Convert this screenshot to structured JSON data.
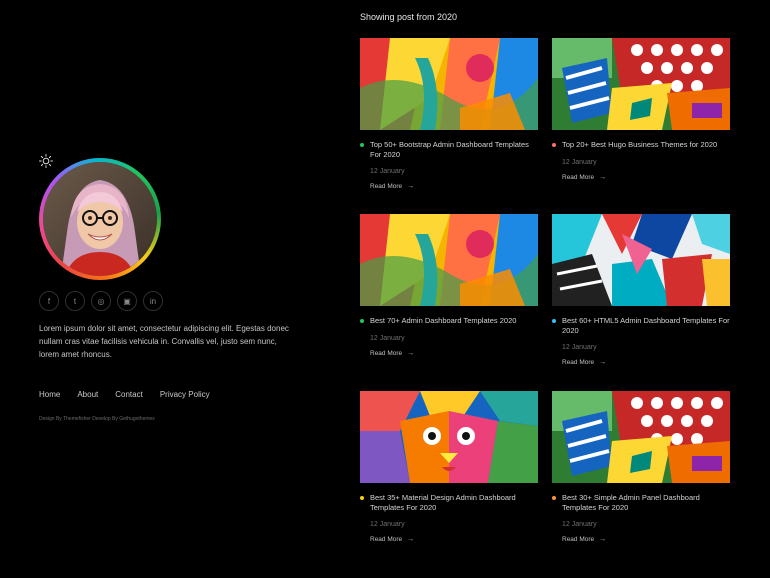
{
  "profile": {
    "theme_icon": "sun-icon",
    "avatar_icon": "avatar-photo",
    "bio": "Lorem ipsum dolor sit amet, consectetur adipiscing elit. Egestas donec nullam cras vitae facilisis vehicula in. Convallis vel, justo sem nunc, lorem amet rhoncus."
  },
  "social": [
    {
      "name": "facebook",
      "label": "f"
    },
    {
      "name": "twitter",
      "label": "t"
    },
    {
      "name": "instagram",
      "label": "◎"
    },
    {
      "name": "github",
      "label": "▣"
    },
    {
      "name": "linkedin",
      "label": "in"
    }
  ],
  "footer": {
    "links": [
      "Home",
      "About",
      "Contact",
      "Privacy Policy"
    ],
    "credit": "Design By Themefisher Develop By Gethugothemes"
  },
  "main": {
    "heading": "Showing post from 2020",
    "posts": [
      {
        "title": "Top 50+ Bootstrap Admin Dashboard Templates For 2020",
        "date": "12 January",
        "read_more": "Read More",
        "dot": "#22c55e",
        "thumb": "abstract-paint-1"
      },
      {
        "title": "Top 20+ Best Hugo Business Themes for 2020",
        "date": "12 January",
        "read_more": "Read More",
        "dot": "#f87171",
        "thumb": "polka-collage"
      },
      {
        "title": "Best 70+ Admin Dashboard Templates 2020",
        "date": "12 January",
        "read_more": "Read More",
        "dot": "#22c55e",
        "thumb": "abstract-paint-1"
      },
      {
        "title": "Best 60+ HTML5 Admin Dashboard Templates For 2020",
        "date": "12 January",
        "read_more": "Read More",
        "dot": "#38bdf8",
        "thumb": "geometric-shapes"
      },
      {
        "title": "Best 35+ Material Design Admin Dashboard Templates For 2020",
        "date": "12 January",
        "read_more": "Read More",
        "dot": "#facc15",
        "thumb": "mosaic-face"
      },
      {
        "title": "Best 30+ Simple Admin Panel Dashboard Templates For 2020",
        "date": "12 January",
        "read_more": "Read More",
        "dot": "#fb923c",
        "thumb": "polka-collage"
      }
    ]
  }
}
